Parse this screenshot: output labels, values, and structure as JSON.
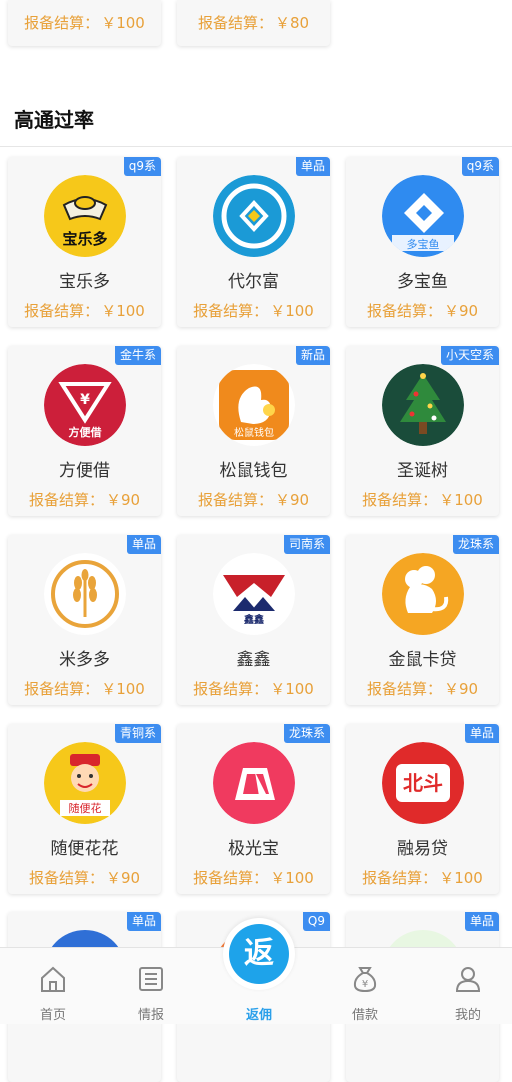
{
  "top_partial": [
    {
      "price_label": "报备结算：",
      "price": "￥100"
    },
    {
      "price_label": "报备结算：",
      "price": "￥80"
    }
  ],
  "section": {
    "title": "高通过率"
  },
  "products": [
    {
      "name": "宝乐多",
      "badge": "q9系",
      "price_label": "报备结算：",
      "price": "￥100",
      "logo_text": "宝乐多"
    },
    {
      "name": "代尔富",
      "badge": "单品",
      "price_label": "报备结算：",
      "price": "￥100",
      "logo_text": ""
    },
    {
      "name": "多宝鱼",
      "badge": "q9系",
      "price_label": "报备结算：",
      "price": "￥90",
      "logo_text": "多宝鱼"
    },
    {
      "name": "方便借",
      "badge": "金牛系",
      "price_label": "报备结算：",
      "price": "￥90",
      "logo_text": "方便借"
    },
    {
      "name": "松鼠钱包",
      "badge": "新品",
      "price_label": "报备结算：",
      "price": "￥90",
      "logo_text": "松鼠钱包"
    },
    {
      "name": "圣诞树",
      "badge": "小天空系",
      "price_label": "报备结算：",
      "price": "￥100",
      "logo_text": ""
    },
    {
      "name": "米多多",
      "badge": "单品",
      "price_label": "报备结算：",
      "price": "￥100",
      "logo_text": ""
    },
    {
      "name": "鑫鑫",
      "badge": "司南系",
      "price_label": "报备结算：",
      "price": "￥100",
      "logo_text": "鑫鑫"
    },
    {
      "name": "金鼠卡贷",
      "badge": "龙珠系",
      "price_label": "报备结算：",
      "price": "￥90",
      "logo_text": ""
    },
    {
      "name": "随便花花",
      "badge": "青铜系",
      "price_label": "报备结算：",
      "price": "￥90",
      "logo_text": "随便花"
    },
    {
      "name": "极光宝",
      "badge": "龙珠系",
      "price_label": "报备结算：",
      "price": "￥100",
      "logo_text": ""
    },
    {
      "name": "融易贷",
      "badge": "单品",
      "price_label": "报备结算：",
      "price": "￥100",
      "logo_text": "北斗"
    }
  ],
  "bottom_partial_badges": [
    "单品",
    "Q9",
    "单品"
  ],
  "fab": {
    "label": "返"
  },
  "tabs": [
    {
      "label": "首页",
      "icon": "home-icon"
    },
    {
      "label": "情报",
      "icon": "news-icon"
    },
    {
      "label": "返佣",
      "icon": "rebate-icon",
      "active": true
    },
    {
      "label": "借款",
      "icon": "money-bag-icon"
    },
    {
      "label": "我的",
      "icon": "user-icon"
    }
  ]
}
